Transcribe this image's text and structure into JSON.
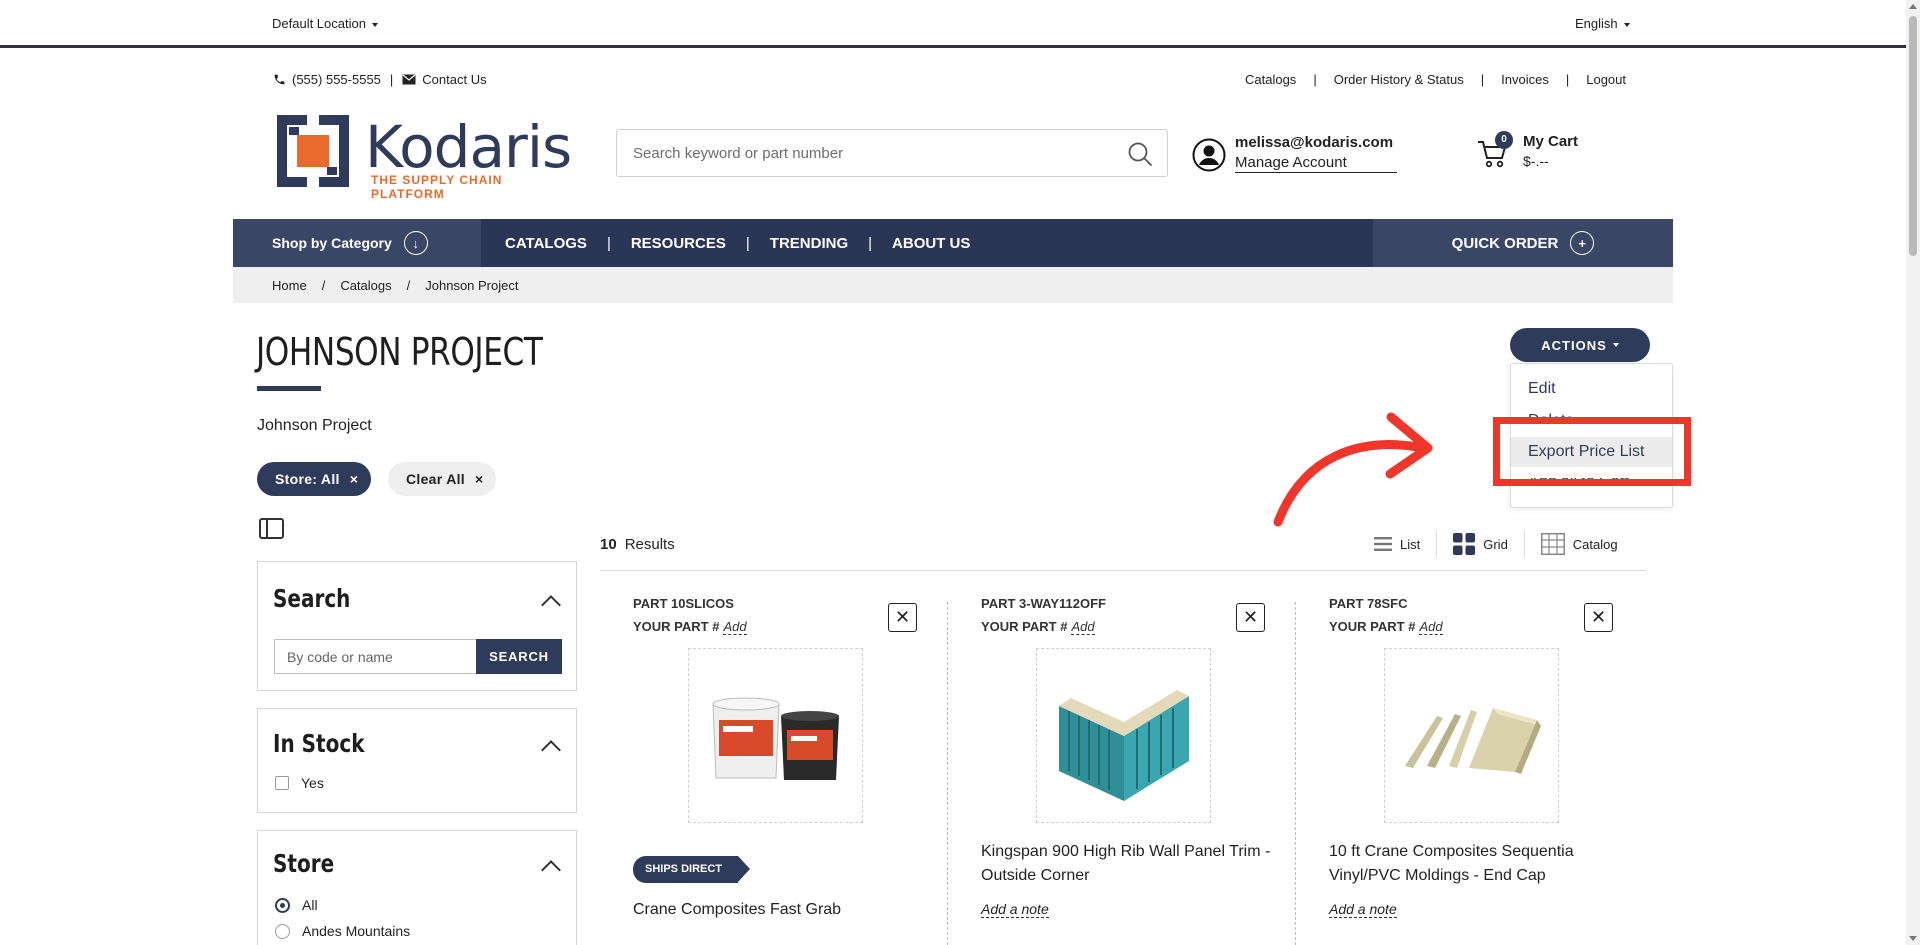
{
  "topbar": {
    "location": "Default Location",
    "language": "English"
  },
  "header": {
    "phone": "(555) 555-5555",
    "contact": "Contact Us",
    "links": [
      "Catalogs",
      "Order History & Status",
      "Invoices",
      "Logout"
    ],
    "logo_word": "Kodaris",
    "logo_tagline": "THE SUPPLY CHAIN PLATFORM",
    "search_placeholder": "Search keyword or part number",
    "account_email": "melissa@kodaris.com",
    "account_manage": "Manage Account",
    "cart_count": "0",
    "cart_title": "My Cart",
    "cart_total": "$-.--"
  },
  "nav": {
    "shop": "Shop by Category",
    "items": [
      "CATALOGS",
      "RESOURCES",
      "TRENDING",
      "ABOUT US"
    ],
    "quick_order": "QUICK ORDER"
  },
  "breadcrumb": [
    "Home",
    "Catalogs",
    "Johnson Project"
  ],
  "page": {
    "title": "JOHNSON PROJECT",
    "subtitle": "Johnson Project",
    "chip_store": "Store: All",
    "chip_clear": "Clear All"
  },
  "actions": {
    "button": "ACTIONS",
    "menu": [
      "Edit",
      "Delete",
      "Export Price List",
      "Add all to Cart"
    ]
  },
  "results": {
    "count": "10",
    "label": "Results",
    "views": [
      "List",
      "Grid",
      "Catalog"
    ]
  },
  "filters": {
    "search_title": "Search",
    "search_placeholder": "By code or name",
    "search_button": "SEARCH",
    "stock_title": "In Stock",
    "stock_option": "Yes",
    "store_title": "Store",
    "store_options": [
      "All",
      "Andes Mountains"
    ]
  },
  "products": [
    {
      "part": "PART 10SLICOS",
      "yourpart_label": "YOUR PART #",
      "yourpart_add": "Add",
      "badge": "SHIPS DIRECT",
      "name": "Crane Composites Fast Grab"
    },
    {
      "part": "PART 3-WAY112OFF",
      "yourpart_label": "YOUR PART #",
      "yourpart_add": "Add",
      "name": "Kingspan 900 High Rib Wall Panel Trim - Outside Corner",
      "note": "Add a note"
    },
    {
      "part": "PART 78SFC",
      "yourpart_label": "YOUR PART #",
      "yourpart_add": "Add",
      "name": "10 ft Crane Composites Sequentia Vinyl/PVC Moldings - End Cap",
      "note": "Add a note"
    }
  ],
  "colors": {
    "brand_navy": "#2f3b5b",
    "brand_orange": "#e86a2c",
    "annotation_red": "#f0352b"
  }
}
